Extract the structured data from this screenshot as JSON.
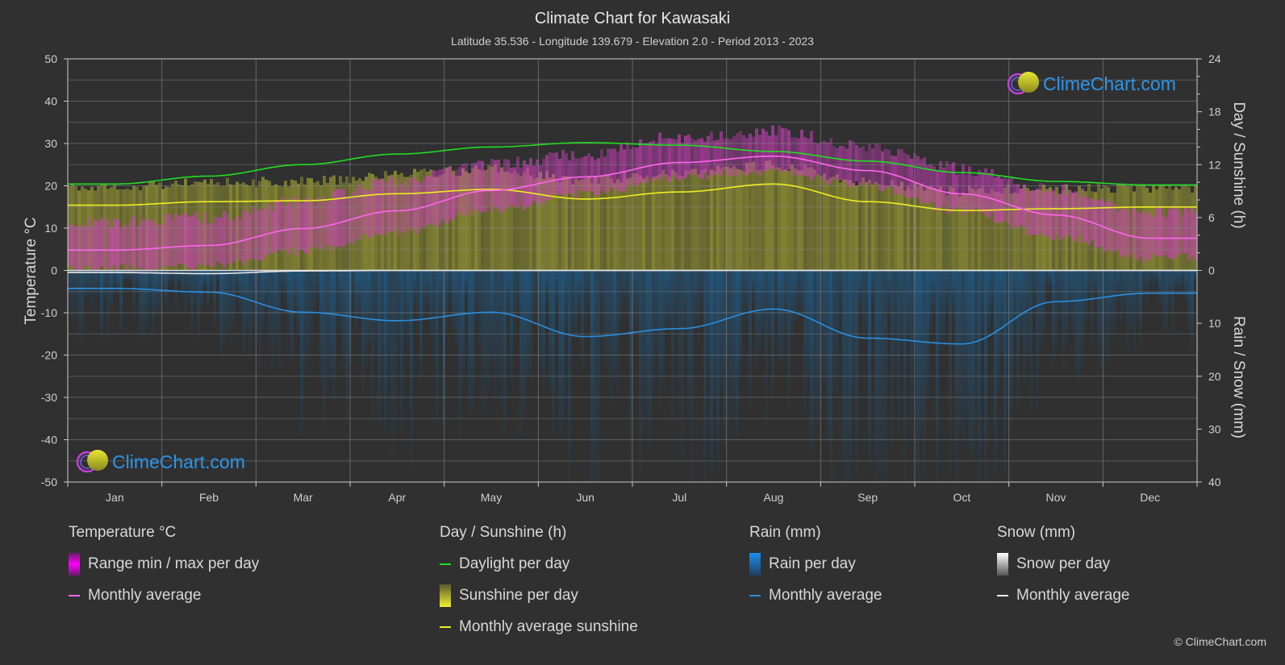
{
  "chart_data": {
    "type": "line",
    "title": "Climate Chart for Kawasaki",
    "subtitle": "Latitude 35.536 - Longitude 139.679 - Elevation 2.0 - Period 2013 - 2023",
    "categories": [
      "Jan",
      "Feb",
      "Mar",
      "Apr",
      "May",
      "Jun",
      "Jul",
      "Aug",
      "Sep",
      "Oct",
      "Nov",
      "Dec"
    ],
    "axes": {
      "left": {
        "label": "Temperature °C",
        "range": [
          -50,
          50
        ],
        "ticks": [
          50,
          40,
          30,
          20,
          10,
          0,
          -10,
          -20,
          -30,
          -40,
          -50
        ]
      },
      "right_top": {
        "label": "Day / Sunshine (h)",
        "range": [
          0,
          24
        ],
        "ticks": [
          24,
          18,
          12,
          6,
          0
        ]
      },
      "right_bottom": {
        "label": "Rain / Snow (mm)",
        "range": [
          0,
          40
        ],
        "ticks": [
          0,
          10,
          20,
          30,
          40
        ]
      }
    },
    "grid": true,
    "series": [
      {
        "name": "Temperature monthly average",
        "unit": "°C",
        "axis": "left",
        "color": "#ff66ee",
        "values": [
          4.8,
          5.9,
          9.9,
          14.1,
          18.9,
          22.1,
          25.5,
          27.0,
          23.6,
          18.1,
          13.1,
          7.6
        ]
      },
      {
        "name": "Daylight per day",
        "unit": "h",
        "axis": "right_top",
        "color": "#22dd22",
        "values": [
          9.8,
          10.7,
          12.0,
          13.2,
          14.0,
          14.5,
          14.2,
          13.5,
          12.4,
          11.1,
          10.1,
          9.7
        ]
      },
      {
        "name": "Monthly average sunshine",
        "unit": "h",
        "axis": "right_top",
        "color": "#eeee22",
        "values": [
          7.4,
          7.8,
          7.9,
          8.7,
          9.2,
          8.1,
          8.9,
          9.8,
          7.8,
          6.8,
          7.0,
          7.2
        ]
      },
      {
        "name": "Rain monthly average",
        "unit": "mm",
        "axis": "right_bottom",
        "color": "#2a8fe0",
        "values": [
          3.4,
          4.1,
          7.9,
          9.5,
          7.9,
          12.5,
          11.0,
          7.3,
          12.8,
          13.9,
          5.9,
          4.3
        ]
      },
      {
        "name": "Snow monthly average",
        "unit": "mm",
        "axis": "right_bottom",
        "color": "#e8e8e8",
        "values": [
          0.4,
          0.6,
          0.1,
          0,
          0,
          0,
          0,
          0,
          0,
          0,
          0,
          0
        ]
      }
    ],
    "temperature_range_approx": {
      "min": [
        1.5,
        2.0,
        5.5,
        10.0,
        15.0,
        19.0,
        23.0,
        24.5,
        21.0,
        15.0,
        9.0,
        4.0
      ],
      "max": [
        10.0,
        11.0,
        15.0,
        19.5,
        23.5,
        26.0,
        30.0,
        31.5,
        28.0,
        22.5,
        17.5,
        12.5
      ]
    },
    "legend_position": "bottom"
  },
  "watermark": {
    "text": "ClimeChart.com"
  },
  "legend": {
    "temperature": {
      "title": "Temperature °C",
      "items": [
        "Range min / max per day",
        "Monthly average"
      ]
    },
    "sunshine": {
      "title": "Day / Sunshine (h)",
      "items": [
        "Daylight per day",
        "Sunshine per day",
        "Monthly average sunshine"
      ]
    },
    "rain": {
      "title": "Rain (mm)",
      "items": [
        "Rain per day",
        "Monthly average"
      ]
    },
    "snow": {
      "title": "Snow (mm)",
      "items": [
        "Snow per day",
        "Monthly average"
      ]
    }
  },
  "copyright": "© ClimeChart.com"
}
